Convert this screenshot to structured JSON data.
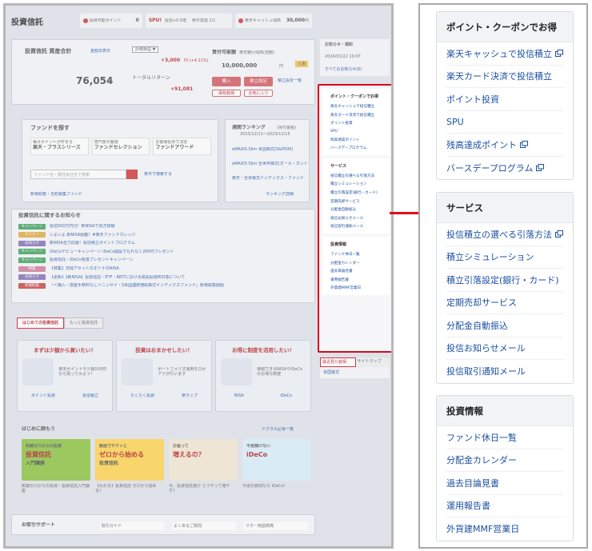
{
  "screenshot": {
    "header": {
      "title": "投資信託",
      "pill1": "投資可能ポイント",
      "pill1_value": "0",
      "pill2": "SPU!",
      "pill2_note": "投信+0.5倍",
      "pill2_cond": "条件達成 1/1",
      "pill3": "楽天キャッシュ残高",
      "pill3_value": "30,000",
      "pill3_unit": "円"
    },
    "assets": {
      "label": "投資信託 資産合計",
      "hide": "金額非表示",
      "eval_select": "評価損益 ▼",
      "eval_value": "+3,000",
      "eval_pct": "円 (+4.11%)",
      "total": "76,054",
      "total_unit": "円",
      "total_return_label": "トータルリターン",
      "total_return_value": "+91,081",
      "buying_power_label": "買付可能額",
      "buying_power_note": "楽天銀行残高(自動)",
      "buying_power_value": "10,000,000",
      "buying_power_unit": "円",
      "badge": "入金",
      "btn_buy": "購入",
      "btn_tsumitate": "積立設定",
      "btn_list": "積立設定一覧",
      "btn_holdings": "保有銘柄",
      "btn_fav": "お気に入り"
    },
    "side_top": {
      "title": "お知らせ・通知",
      "date": "2024/01/22 10:07",
      "link": "すべてのお知らせ(0)"
    },
    "fund_search": {
      "title": "ファンドを探す",
      "cats": [
        {
          "sub": "毎月ポイントが貯まる",
          "main": "楽天・プラスシリーズ"
        },
        {
          "sub": "専門家が厳選",
          "main": "ファンドセレクション"
        },
        {
          "sub": "お客様投票で決定",
          "main": "ファンドアワード"
        }
      ],
      "placeholder": "ファンド名・委託会社名で検索",
      "cond": "条件で検索する",
      "new": "新規取扱・当初募集ファンド"
    },
    "ranking": {
      "title": "週間ランキング",
      "note": "(買付金額)",
      "period": "2023/12/11〜2023/12/15",
      "items": [
        "eMAXIS Slim 米国株式(S&P500)",
        "eMAXIS Slim 全世界株式(オール・カントリー)",
        "楽天・全米株式インデックス・ファンド"
      ],
      "more": "ランキング詳細"
    },
    "news": {
      "title": "投資信託に関するお知らせ",
      "rows": [
        {
          "tag": "キャンペーン",
          "color": "#3aa055",
          "text": "投信500万円分！新NISAで買方体験"
        },
        {
          "tag": "セミナー",
          "color": "#e0a93a",
          "text": "いよいよ 新NISA始動！#楽天ファンドカレッジ"
        },
        {
          "tag": "お知らせ",
          "color": "#7f6bb3",
          "text": "新NISA全力応援！投信積立ポイントプログラム"
        },
        {
          "tag": "キャンペーン",
          "color": "#3aa055",
          "text": "iDeCoデビューキャンペーン iDeCo開設でもれなく200円プレゼント"
        },
        {
          "tag": "キャンペーン",
          "color": "#3aa055",
          "text": "投資信託・iDeCo各賞プレゼントキャンペーン"
        },
        {
          "tag": "特集",
          "color": "#d07a9a",
          "text": "【特集】日興アセットのオトナのNISA"
        },
        {
          "tag": "お知らせ",
          "color": "#7f6bb3",
          "text": "【更新】【新NISA】投資信託・ETF・REITにおける成長投資枠対象について"
        },
        {
          "tag": "新規取扱",
          "color": "#c84040",
          "text": "「＜購入・換金手数料なし＞ニッセイ・S米国連続増配株式インデックスファンド」新規取扱開始"
        }
      ]
    },
    "tabs": [
      "はじめての投資信託",
      "もっと投資信託"
    ],
    "promos": [
      {
        "title": "まずは少額から買いたい！",
        "note": "楽天ポイントや少額100円から買ってみよう！",
        "link1": "ポイント投資",
        "link2": "投信積立"
      },
      {
        "title": "投資はおまかせしたい！",
        "note": "ポートフォリオ運用をロボアドが行います",
        "link1": "らくらく投資",
        "link2": "楽ラップ"
      },
      {
        "title": "お得に制度を活用したい！",
        "note": "節税できるNISAやiDeCoのお得な制度",
        "link1": "NISA",
        "link2": "iDeCo"
      }
    ],
    "hajimete": {
      "title": "はじめに読もう",
      "more": "ドクラル記事一覧",
      "banners": [
        {
          "l1": "知識ゼロからの投資",
          "l2": "投資信託",
          "l3": "入門講座",
          "bg": "#88c23a",
          "cap": "知識ゼロからの投資・投資信託入門講座"
        },
        {
          "l1": "動画でサクッと",
          "l2": "ゼロから始める",
          "l3": "投資信託",
          "bg": "#ffd34a",
          "cap": "【わかる】投資信託 ゼロから始める！"
        },
        {
          "l1": "お金って",
          "l2": "増えるの？",
          "l3": "",
          "bg": "#f3e7cf",
          "cap": "今、投資信託選び どうやって増やす？"
        },
        {
          "l1": "今更聞けない",
          "l2": "iDeCo",
          "l3": "",
          "bg": "#d8eef8",
          "cap": "今更の質問なら iDeCo！"
        }
      ]
    },
    "support": {
      "title": "お取引サポート",
      "items": [
        "取引ガイド",
        "よくあるご質問",
        "マネー用語辞典"
      ]
    },
    "side_bottom": {
      "tab1": "最近見た銘柄",
      "tab2": "サイトマップ",
      "item": "米国株式"
    }
  },
  "menu": {
    "sections": [
      {
        "title": "ポイント・クーポンでお得",
        "items": [
          {
            "label": "楽天キャッシュで投信積立",
            "ext": true
          },
          {
            "label": "楽天カード決済で投信積立",
            "ext": false
          },
          {
            "label": "ポイント投資",
            "ext": false
          },
          {
            "label": "SPU",
            "ext": false
          },
          {
            "label": "残高達成ポイント",
            "ext": true
          },
          {
            "label": "バースデープログラム",
            "ext": true
          }
        ]
      },
      {
        "title": "サービス",
        "items": [
          {
            "label": "投信積立の選べる引落方法",
            "ext": true
          },
          {
            "label": "積立シミュレーション",
            "ext": false
          },
          {
            "label": "積立引落設定(銀行・カード)",
            "ext": false
          },
          {
            "label": "定期売却サービス",
            "ext": false
          },
          {
            "label": "分配金自動振込",
            "ext": false
          },
          {
            "label": "投信お知らせメール",
            "ext": false
          },
          {
            "label": "投信取引通知メール",
            "ext": false
          }
        ]
      },
      {
        "title": "投資情報",
        "items": [
          {
            "label": "ファンド休日一覧",
            "ext": false
          },
          {
            "label": "分配金カレンダー",
            "ext": false
          },
          {
            "label": "過去目論見書",
            "ext": false
          },
          {
            "label": "運用報告書",
            "ext": false
          },
          {
            "label": "外貨建MMF営業日",
            "ext": false
          }
        ]
      }
    ]
  },
  "colors": {
    "highlight": "#e20d1e",
    "link": "#1b4fa1",
    "brand": "#b5161f"
  }
}
